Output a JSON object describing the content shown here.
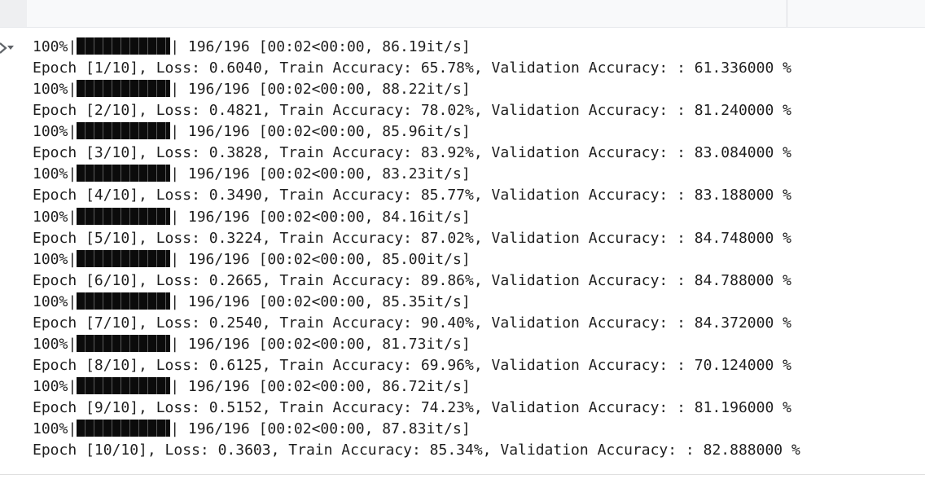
{
  "toolbar": {
    "output_toggle_icon": "collapse-output-icon"
  },
  "output": {
    "progress_rows": [
      {
        "percent": "100%",
        "sep": "|",
        "tail": "| 196/196 [00:02<00:00, 86.19it/s]",
        "fill": 1.0
      },
      {
        "percent": "100%",
        "sep": "|",
        "tail": "| 196/196 [00:02<00:00, 88.22it/s]",
        "fill": 1.0
      },
      {
        "percent": "100%",
        "sep": "|",
        "tail": "| 196/196 [00:02<00:00, 85.96it/s]",
        "fill": 1.0
      },
      {
        "percent": "100%",
        "sep": "|",
        "tail": "| 196/196 [00:02<00:00, 83.23it/s]",
        "fill": 1.0
      },
      {
        "percent": "100%",
        "sep": "|",
        "tail": "| 196/196 [00:02<00:00, 84.16it/s]",
        "fill": 1.0
      },
      {
        "percent": "100%",
        "sep": "|",
        "tail": "| 196/196 [00:02<00:00, 85.00it/s]",
        "fill": 1.0
      },
      {
        "percent": "100%",
        "sep": "|",
        "tail": "| 196/196 [00:02<00:00, 85.35it/s]",
        "fill": 1.0
      },
      {
        "percent": "100%",
        "sep": "|",
        "tail": "| 196/196 [00:02<00:00, 81.73it/s]",
        "fill": 1.0
      },
      {
        "percent": "100%",
        "sep": "|",
        "tail": "| 196/196 [00:02<00:00, 86.72it/s]",
        "fill": 1.0
      },
      {
        "percent": "100%",
        "sep": "|",
        "tail": "| 196/196 [00:02<00:00, 87.83it/s]",
        "fill": 1.0
      }
    ],
    "epoch_rows": [
      "Epoch [1/10], Loss: 0.6040, Train Accuracy: 65.78%, Validation Accuracy: : 61.336000 %",
      "Epoch [2/10], Loss: 0.4821, Train Accuracy: 78.02%, Validation Accuracy: : 81.240000 %",
      "Epoch [3/10], Loss: 0.3828, Train Accuracy: 83.92%, Validation Accuracy: : 83.084000 %",
      "Epoch [4/10], Loss: 0.3490, Train Accuracy: 85.77%, Validation Accuracy: : 83.188000 %",
      "Epoch [5/10], Loss: 0.3224, Train Accuracy: 87.02%, Validation Accuracy: : 84.748000 %",
      "Epoch [6/10], Loss: 0.2665, Train Accuracy: 89.86%, Validation Accuracy: : 84.788000 %",
      "Epoch [7/10], Loss: 0.2540, Train Accuracy: 90.40%, Validation Accuracy: : 84.372000 %",
      "Epoch [8/10], Loss: 0.6125, Train Accuracy: 69.96%, Validation Accuracy: : 70.124000 %",
      "Epoch [9/10], Loss: 0.5152, Train Accuracy: 74.23%, Validation Accuracy: : 81.196000 %",
      "Epoch [10/10], Loss: 0.3603, Train Accuracy: 85.34%, Validation Accuracy: : 82.888000 %"
    ]
  }
}
